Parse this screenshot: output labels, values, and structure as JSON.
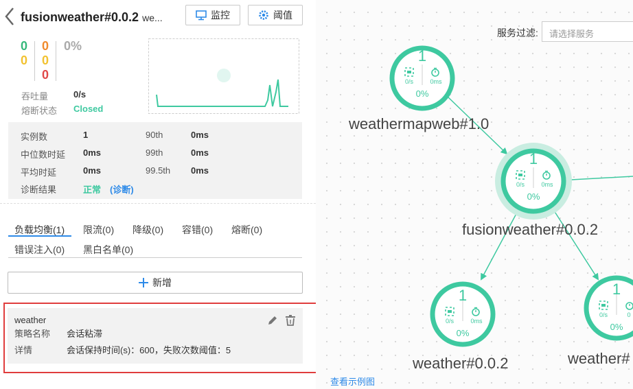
{
  "header": {
    "title": "fusionweather#0.0.2",
    "title_suffix": "we...",
    "monitor_label": "监控",
    "threshold_label": "阈值"
  },
  "counts": {
    "col1": [
      "0",
      "0"
    ],
    "col2": [
      "0",
      "0",
      "0"
    ],
    "percent": "0%"
  },
  "summary": {
    "throughput_label": "吞吐量",
    "throughput_value": "0/s",
    "breaker_label": "熔断状态",
    "breaker_value": "Closed"
  },
  "stats": {
    "instances_label": "实例数",
    "instances_value": "1",
    "p90_label": "90th",
    "p90_value": "0ms",
    "median_label": "中位数时延",
    "median_value": "0ms",
    "p99_label": "99th",
    "p99_value": "0ms",
    "avg_label": "平均时延",
    "avg_value": "0ms",
    "p995_label": "99.5th",
    "p995_value": "0ms",
    "diagnosis_label": "诊断结果",
    "diagnosis_value": "正常",
    "diagnosis_link": "(诊断)"
  },
  "tabs": [
    {
      "label": "负载均衡(1)",
      "active": true
    },
    {
      "label": "限流(0)"
    },
    {
      "label": "降级(0)"
    },
    {
      "label": "容错(0)"
    },
    {
      "label": "熔断(0)"
    },
    {
      "label": "错误注入(0)"
    },
    {
      "label": "黑白名单(0)"
    }
  ],
  "add_button": "新增",
  "policy_card": {
    "name": "weather",
    "strategy_label": "策略名称",
    "strategy_value": "会话粘滞",
    "detail_label": "详情",
    "detail_value": "会话保持时间(s)：600，失败次数阈值：5"
  },
  "topology": {
    "filter_label": "服务过滤:",
    "filter_placeholder": "请选择服务",
    "example_link": "查看示例图",
    "nodes": [
      {
        "name": "weathermapweb#1.0",
        "count": "1",
        "rate": "0/s",
        "latency": "0ms",
        "percent": "0%"
      },
      {
        "name": "fusionweather#0.0.2",
        "count": "1",
        "rate": "0/s",
        "latency": "0ms",
        "percent": "0%"
      },
      {
        "name": "weather#0.0.2",
        "count": "1",
        "rate": "0/s",
        "latency": "0ms",
        "percent": "0%"
      },
      {
        "name": "weather#",
        "count": "1",
        "rate": "0/s",
        "latency": "0",
        "percent": "0%"
      }
    ]
  },
  "colors": {
    "accent_green": "#3ec9a0",
    "link_blue": "#2d8ae8",
    "zero_green": "#35b87a",
    "zero_yellow": "#f2c230",
    "zero_orange": "#f08a2c",
    "zero_red": "#e04848",
    "highlight_border": "#e03c3c"
  }
}
